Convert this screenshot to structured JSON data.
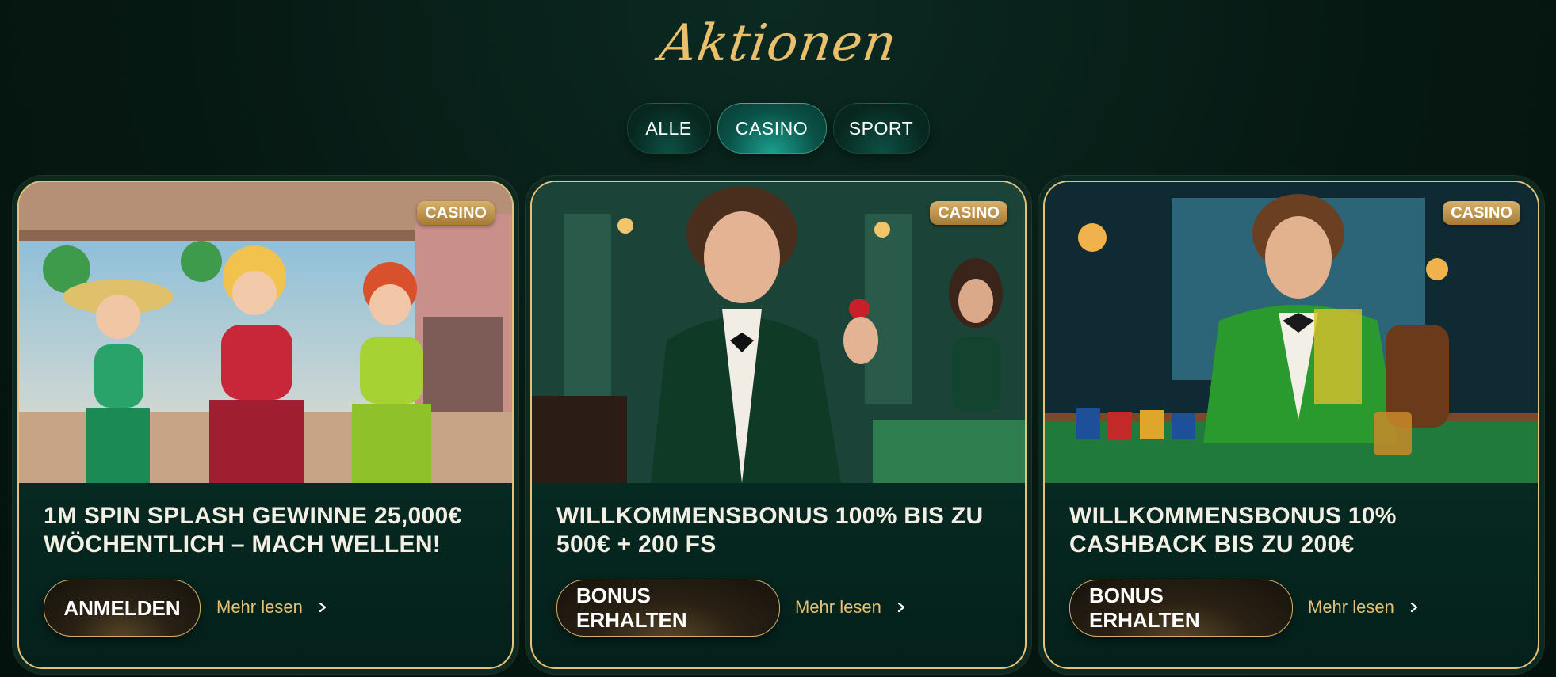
{
  "page": {
    "title": "Aktionen"
  },
  "tabs": [
    {
      "label": "ALLE",
      "active": false
    },
    {
      "label": "CASINO",
      "active": true
    },
    {
      "label": "SPORT",
      "active": false
    }
  ],
  "cards": [
    {
      "badge": "CASINO",
      "title": "1M SPIN SPLASH GEWINNE 25,000€ WÖCHENTLICH – MACH WELLEN!",
      "cta": "ANMELDEN",
      "more": "Mehr lesen",
      "art": "beach-casino-illustration"
    },
    {
      "badge": "CASINO",
      "title": "WILLKOMMENSBONUS 100% BIS ZU 500€ + 200 FS",
      "cta": "BONUS ERHALTEN",
      "more": "Mehr lesen",
      "art": "casino-gentleman-illustration"
    },
    {
      "badge": "CASINO",
      "title": "WILLKOMMENSBONUS 10% CASHBACK BIS ZU 200€",
      "cta": "BONUS ERHALTEN",
      "more": "Mehr lesen",
      "art": "poker-table-illustration"
    }
  ],
  "colors": {
    "background": "#061812",
    "gold": "#e4c27a",
    "accent_teal": "#1aa08e",
    "title_gold": "#e9bf6b"
  },
  "icons": {
    "more_arrow": "chevron-right-icon"
  }
}
